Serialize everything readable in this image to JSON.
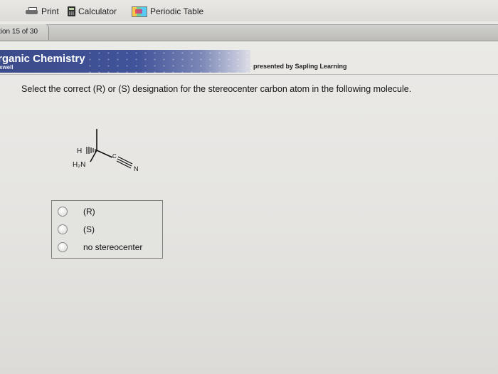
{
  "toolbar": {
    "items": [
      {
        "label": "Print",
        "icon": "printer-icon"
      },
      {
        "label": "Calculator",
        "icon": "calculator-icon"
      },
      {
        "label": "Periodic Table",
        "icon": "periodic-table-icon"
      }
    ]
  },
  "question_counter": "tion 15 of 30",
  "banner": {
    "title": "rganic Chemistry",
    "subtitle": "xwell",
    "presented_by": "presented by Sapling Learning"
  },
  "question": {
    "text": "Select the correct (R) or (S) designation for the stereocenter carbon atom in the following molecule.",
    "molecule": {
      "label_h": "H",
      "label_nh2": "H₂N",
      "label_c": "C",
      "label_n": "N"
    }
  },
  "answers": {
    "options": [
      "(R)",
      "(S)",
      "no stereocenter"
    ]
  },
  "colors": {
    "banner": "#41539a",
    "background": "#e6e6e4"
  }
}
